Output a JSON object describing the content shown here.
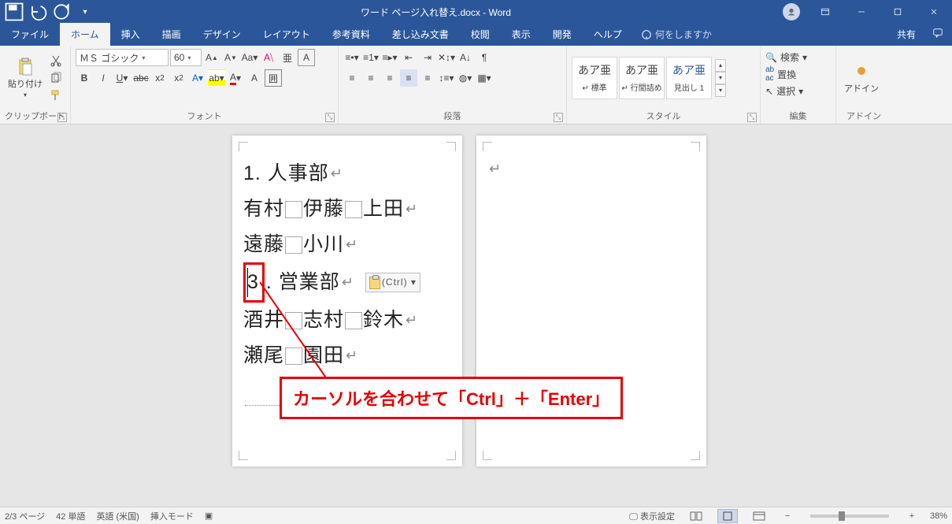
{
  "title": "ワード ページ入れ替え.docx - Word",
  "qat": {
    "save": "save-icon",
    "undo": "undo-icon",
    "redo": "redo-icon",
    "more": "▾"
  },
  "tabs": [
    "ファイル",
    "ホーム",
    "挿入",
    "描画",
    "デザイン",
    "レイアウト",
    "参考資料",
    "差し込み文書",
    "校閲",
    "表示",
    "開発",
    "ヘルプ"
  ],
  "active_tab": 1,
  "tellme_placeholder": "何をしますか",
  "share_label": "共有",
  "ribbon": {
    "clipboard": {
      "label": "クリップボード",
      "paste": "貼り付け"
    },
    "font": {
      "label": "フォント",
      "name": "ＭＳ ゴシック",
      "size": "60"
    },
    "paragraph": {
      "label": "段落"
    },
    "styles": {
      "label": "スタイル",
      "items": [
        {
          "sample": "あア亜",
          "name": "↵ 標準"
        },
        {
          "sample": "あア亜",
          "name": "↵ 行間詰め"
        },
        {
          "sample": "あア亜",
          "name": "見出し 1"
        }
      ]
    },
    "editing": {
      "label": "編集",
      "find": "検索",
      "replace": "置換",
      "select": "選択"
    },
    "addins": {
      "label": "アドイン",
      "btn": "アドイン"
    }
  },
  "document": {
    "page1": {
      "lines": [
        {
          "type": "text",
          "parts": [
            "1. 人事部"
          ]
        },
        {
          "type": "names",
          "parts": [
            "有村",
            "伊藤",
            "上田"
          ]
        },
        {
          "type": "names",
          "parts": [
            "遠藤",
            "小川"
          ]
        },
        {
          "type": "cursor",
          "num": "3",
          "rest": ". 営業部",
          "paste_hint": "(Ctrl) ▾"
        },
        {
          "type": "names",
          "parts": [
            "酒井",
            "志村",
            "鈴木"
          ]
        },
        {
          "type": "names",
          "parts": [
            "瀬尾",
            "園田"
          ]
        }
      ]
    }
  },
  "annotation": "カーソルを合わせて「Ctrl」＋「Enter」",
  "status": {
    "page": "2/3 ページ",
    "words": "42 単語",
    "lang": "英語 (米国)",
    "mode": "挿入モード",
    "display_settings": "表示設定",
    "zoom": "38%"
  }
}
